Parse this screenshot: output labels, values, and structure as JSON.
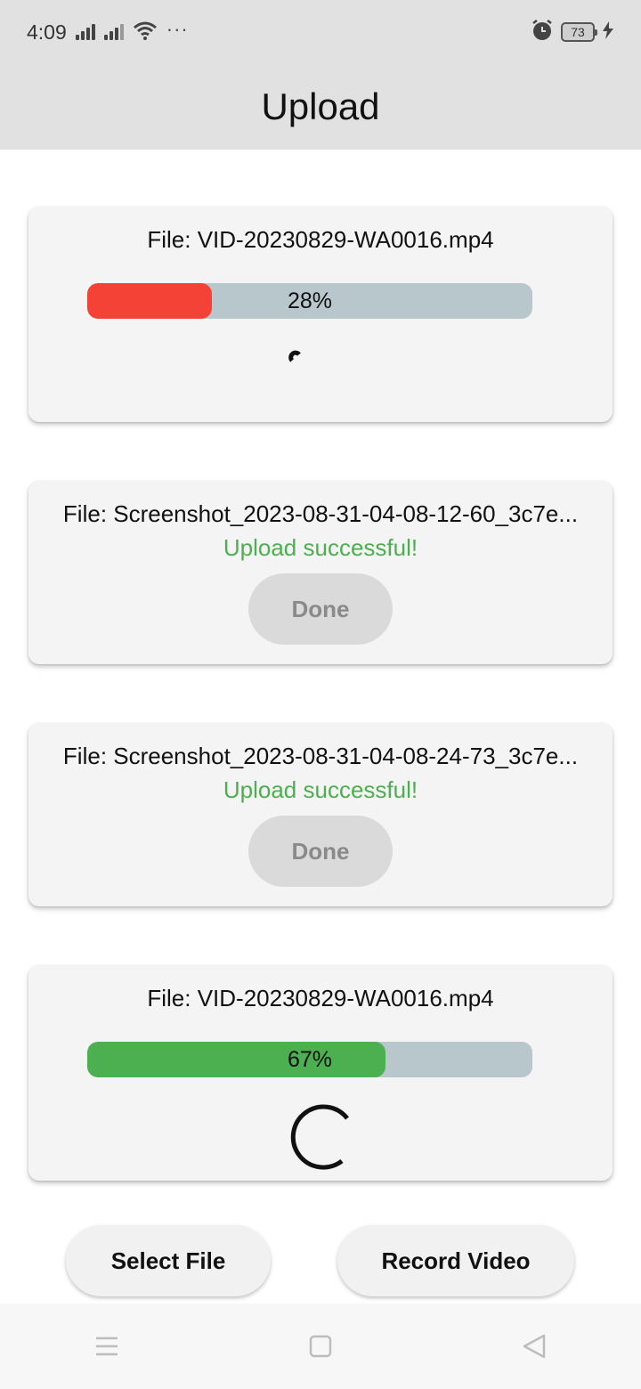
{
  "status_bar": {
    "time": "4:09",
    "battery": "73",
    "dots": "···"
  },
  "app_bar": {
    "title": "Upload"
  },
  "uploads": [
    {
      "file_label": "File: VID-20230829-WA0016.mp4",
      "progress_text": "28%",
      "progress": 0.28,
      "bar_color": "#f44336"
    },
    {
      "file_label": "File: Screenshot_2023-08-31-04-08-12-60_3c7e...",
      "status": "Upload successful!",
      "button_label": "Done"
    },
    {
      "file_label": "File: Screenshot_2023-08-31-04-08-24-73_3c7e...",
      "status": "Upload successful!",
      "button_label": "Done"
    },
    {
      "file_label": "File: VID-20230829-WA0016.mp4",
      "progress_text": "67%",
      "progress": 0.67,
      "bar_color": "#4caf50"
    }
  ],
  "actions": {
    "select_file": "Select File",
    "record_video": "Record Video"
  },
  "colors": {
    "success": "#4caf50",
    "error_bar": "#f44336",
    "track": "#b8c7cc",
    "app_bar_bg": "#e1e1e1"
  },
  "icons": {
    "nav": [
      "menu-icon",
      "home-square-icon",
      "back-triangle-icon"
    ],
    "status": [
      "signal-icon",
      "wifi-icon",
      "alarm-icon",
      "battery-icon",
      "charging-icon"
    ]
  }
}
